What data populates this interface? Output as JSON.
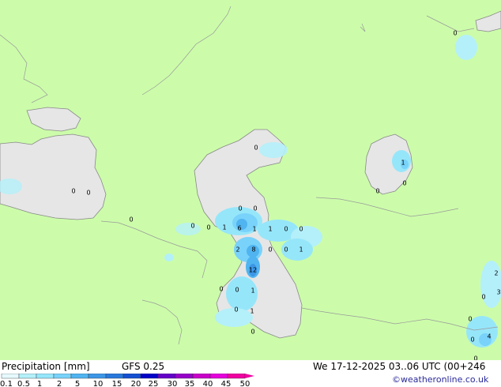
{
  "map": {
    "colors": {
      "land": "#ccfcaa",
      "sea": "#e6e6e6",
      "coast": "#888888",
      "border": "#999999"
    },
    "value_labels": [
      {
        "name": "label-ne-steppe",
        "text": "0"
      },
      {
        "name": "label-north-caspian",
        "text": "0"
      },
      {
        "name": "label-black-sea-1",
        "text": "0"
      },
      {
        "name": "label-black-sea-2",
        "text": "0"
      },
      {
        "name": "label-caucasus",
        "text": "0"
      },
      {
        "name": "label-georgia",
        "text": "0"
      },
      {
        "name": "label-georgia-2",
        "text": "0"
      },
      {
        "name": "label-georgia-3",
        "text": "1"
      },
      {
        "name": "label-mid-caspian-a",
        "text": "0"
      },
      {
        "name": "label-mid-caspian-b",
        "text": "0"
      },
      {
        "name": "label-mid-caspian-c",
        "text": "6"
      },
      {
        "name": "label-mid-caspian-d",
        "text": "1"
      },
      {
        "name": "label-mid-caspian-e",
        "text": "1"
      },
      {
        "name": "label-mid-caspian-f",
        "text": "0"
      },
      {
        "name": "label-mid-caspian-g",
        "text": "0"
      },
      {
        "name": "label-aral-1",
        "text": "1"
      },
      {
        "name": "label-aral-2",
        "text": "0"
      },
      {
        "name": "label-south-caspian-a",
        "text": "2"
      },
      {
        "name": "label-south-caspian-b",
        "text": "8"
      },
      {
        "name": "label-south-caspian-c",
        "text": "0"
      },
      {
        "name": "label-south-caspian-d",
        "text": "0"
      },
      {
        "name": "label-south-caspian-e",
        "text": "1"
      },
      {
        "name": "label-south-caspian-12",
        "text": "12"
      },
      {
        "name": "label-iran-1",
        "text": "0"
      },
      {
        "name": "label-iran-2",
        "text": "0"
      },
      {
        "name": "label-iran-3",
        "text": "1"
      },
      {
        "name": "label-iran-4",
        "text": "0"
      },
      {
        "name": "label-iran-5",
        "text": "1"
      },
      {
        "name": "label-iran-6",
        "text": "0"
      },
      {
        "name": "label-ural-east",
        "text": "0"
      },
      {
        "name": "label-far-east-1",
        "text": "2"
      },
      {
        "name": "label-far-east-2",
        "text": "3"
      },
      {
        "name": "label-far-east-3",
        "text": "0"
      },
      {
        "name": "label-far-east-4",
        "text": "4"
      },
      {
        "name": "label-far-east-5",
        "text": "0"
      },
      {
        "name": "label-far-east-6",
        "text": "0"
      },
      {
        "name": "label-balkhash",
        "text": "0"
      }
    ]
  },
  "footer": {
    "title": "Precipitation [mm]",
    "model": "GFS 0.25",
    "datetime": "We 17-12-2025 03..06 UTC (00+246",
    "credit": "©weatheronline.co.uk"
  },
  "scale": {
    "ticks": [
      "0.1",
      "0.5",
      "1",
      "2",
      "5",
      "10",
      "15",
      "20",
      "25",
      "30",
      "35",
      "40",
      "45",
      "50"
    ],
    "colors": [
      "#e6fafe",
      "#b4f0fa",
      "#96e6fa",
      "#78d2fa",
      "#50b4f0",
      "#3c96e6",
      "#2878dc",
      "#1450d2",
      "#0000c8",
      "#6400c8",
      "#9600c8",
      "#c800c8",
      "#e600dc",
      "#f000a0"
    ]
  }
}
